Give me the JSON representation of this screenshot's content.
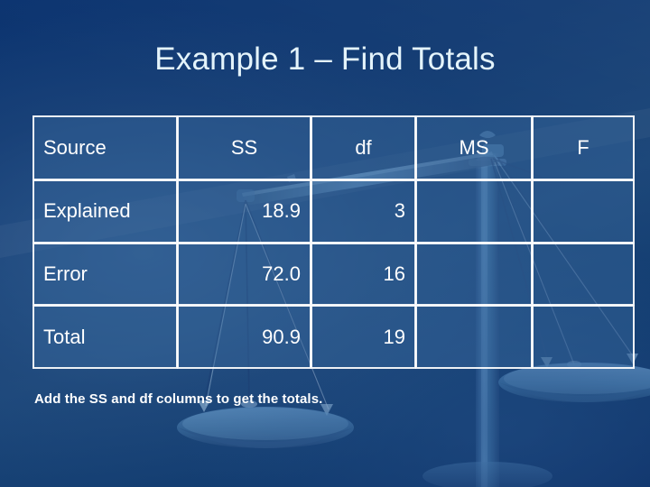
{
  "slide": {
    "title": "Example 1 – Find Totals",
    "caption": "Add the SS and df columns to get the totals.",
    "background_watermark": "balance-scale",
    "colors": {
      "background_top": "#0c3470",
      "background_mid": "#2d5281",
      "title_text": "#e4f4fb",
      "cell_fill": "#2c5380",
      "cell_border": "#ffffff",
      "body_text": "#ffffff",
      "dither_cell": "#3a73a8"
    }
  },
  "table": {
    "columns": [
      {
        "key": "source",
        "label": "Source",
        "align": "left"
      },
      {
        "key": "ss",
        "label": "SS",
        "align": "center"
      },
      {
        "key": "df",
        "label": "df",
        "align": "center"
      },
      {
        "key": "ms",
        "label": "MS",
        "align": "center"
      },
      {
        "key": "f",
        "label": "F",
        "align": "center"
      }
    ],
    "rows": [
      {
        "source": "Explained",
        "ss": "18.9",
        "df": "3",
        "ms": "",
        "f": ""
      },
      {
        "source": "Error",
        "ss": "72.0",
        "df": "16",
        "ms": "",
        "f": ""
      },
      {
        "source": "Total",
        "ss": "90.9",
        "df": "19",
        "ms": "",
        "f": ""
      }
    ]
  }
}
